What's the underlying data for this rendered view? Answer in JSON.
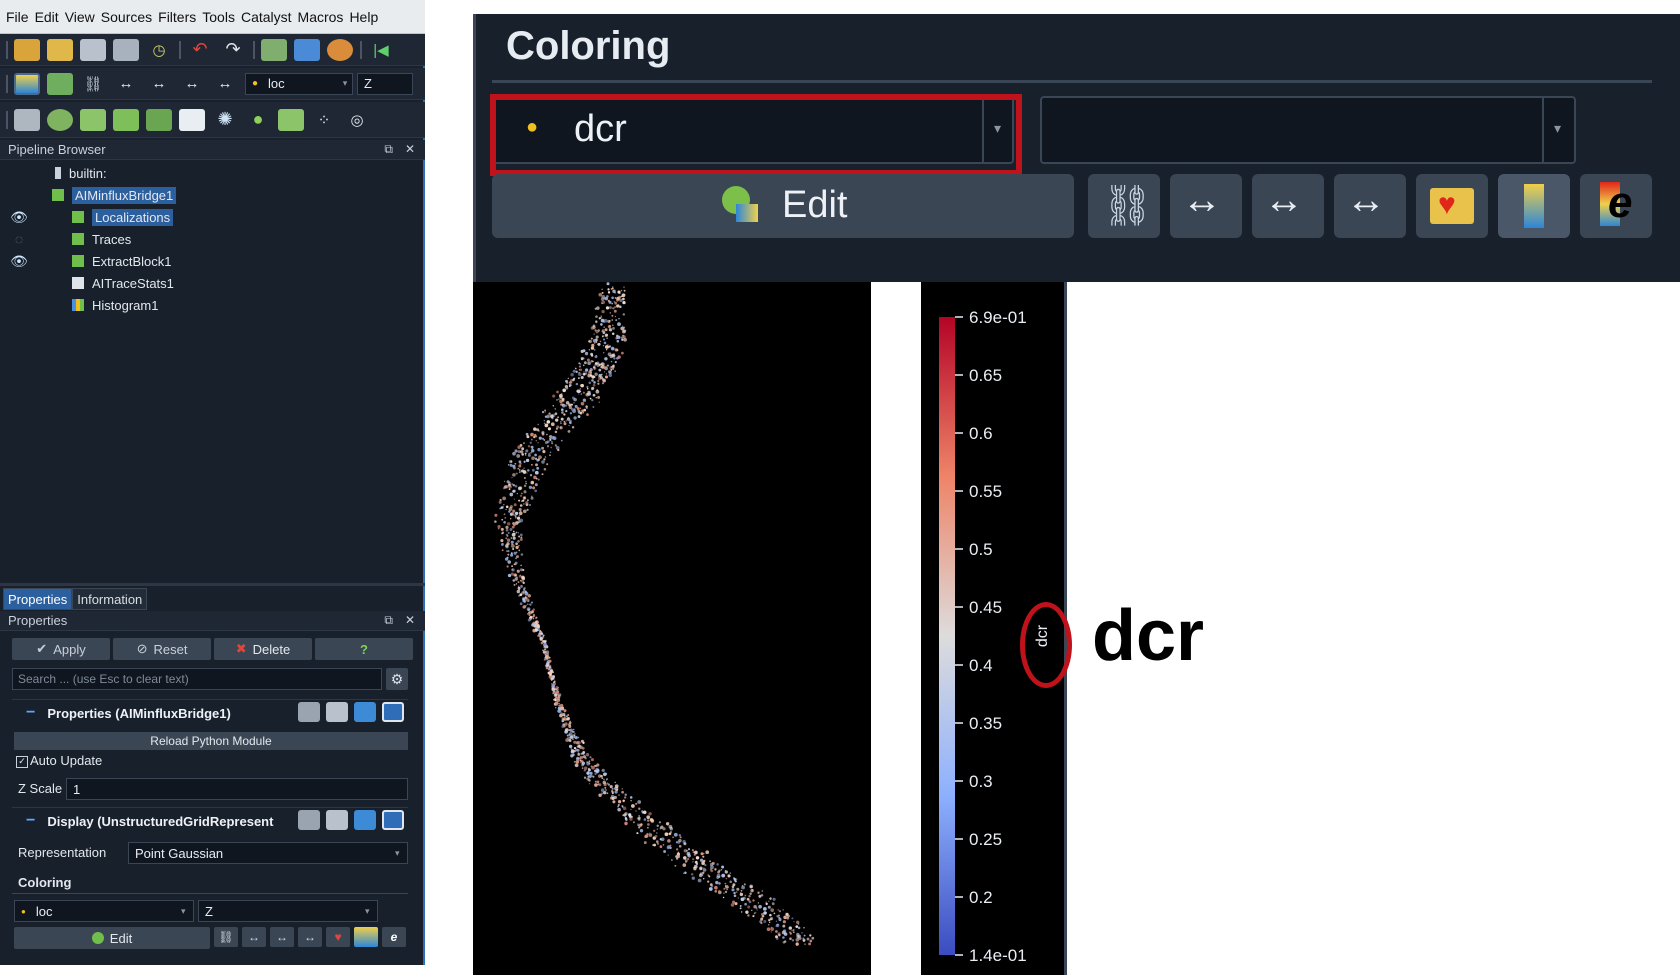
{
  "menu": [
    "File",
    "Edit",
    "View",
    "Sources",
    "Filters",
    "Tools",
    "Catalyst",
    "Macros",
    "Help"
  ],
  "toolbar2": {
    "array_value": "loc",
    "component_value": "Z"
  },
  "pipeline": {
    "title": "Pipeline Browser",
    "items": [
      {
        "label": "builtin:"
      },
      {
        "label": "AIMinfluxBridge1",
        "selected": true
      },
      {
        "label": "Localizations",
        "selected": true,
        "visible": true
      },
      {
        "label": "Traces"
      },
      {
        "label": "ExtractBlock1",
        "visible": true
      },
      {
        "label": "AITraceStats1"
      },
      {
        "label": "Histogram1"
      }
    ]
  },
  "tabs": {
    "properties": "Properties",
    "information": "Information"
  },
  "properties": {
    "title": "Properties",
    "apply": "Apply",
    "reset": "Reset",
    "delete": "Delete",
    "help": "?",
    "search_placeholder": "Search ... (use Esc to clear text)",
    "section1": "Properties (AIMinfluxBridge1)",
    "reload": "Reload Python Module",
    "auto_update": "Auto Update",
    "zscale_label": "Z Scale",
    "zscale_value": "1",
    "section2": "Display (UnstructuredGridRepresent",
    "representation_label": "Representation",
    "representation_value": "Point Gaussian",
    "coloring_label": "Coloring",
    "coloring_array": "loc",
    "coloring_component": "Z",
    "edit": "Edit"
  },
  "zoom": {
    "title": "Coloring",
    "array_value": "dcr",
    "edit": "Edit"
  },
  "colorbar": {
    "title": "dcr",
    "labels": [
      "6.9e-01",
      "0.65",
      "0.6",
      "0.55",
      "0.5",
      "0.45",
      "0.4",
      "0.35",
      "0.3",
      "0.25",
      "0.2",
      "1.4e-01"
    ],
    "max": 0.69,
    "min": 0.14
  },
  "annotation": "dcr",
  "colors": {
    "highlight": "#c0121b",
    "bg": "#18202b",
    "selection": "#2c5f9e"
  }
}
